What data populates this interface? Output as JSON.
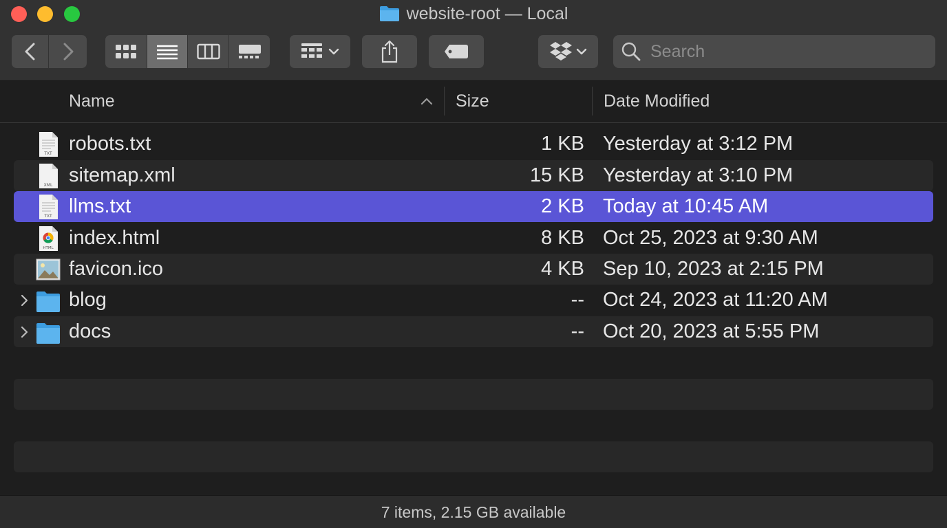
{
  "window": {
    "title": "website-root — Local"
  },
  "toolbar": {
    "back": "back",
    "forward": "forward",
    "search_placeholder": "Search"
  },
  "columns": {
    "name": "Name",
    "size": "Size",
    "date": "Date Modified",
    "sort_column": "Name",
    "sort_direction": "ascending"
  },
  "files": [
    {
      "name": "robots.txt",
      "size": "1 KB",
      "date": "Yesterday at 3:12 PM",
      "icon": "text-file-icon",
      "kind": "file",
      "selected": false
    },
    {
      "name": "sitemap.xml",
      "size": "15 KB",
      "date": "Yesterday at 3:10 PM",
      "icon": "xml-file-icon",
      "kind": "file",
      "selected": false
    },
    {
      "name": "llms.txt",
      "size": "2 KB",
      "date": "Today at 10:45 AM",
      "icon": "text-file-icon",
      "kind": "file",
      "selected": true
    },
    {
      "name": "index.html",
      "size": "8 KB",
      "date": "Oct 25, 2023 at 9:30 AM",
      "icon": "html-file-icon",
      "kind": "file",
      "selected": false
    },
    {
      "name": "favicon.ico",
      "size": "4 KB",
      "date": "Sep 10, 2023 at 2:15 PM",
      "icon": "image-file-icon",
      "kind": "file",
      "selected": false
    },
    {
      "name": "blog",
      "size": "--",
      "date": "Oct 24, 2023 at 11:20 AM",
      "icon": "folder-icon",
      "kind": "folder",
      "selected": false
    },
    {
      "name": "docs",
      "size": "--",
      "date": "Oct 20, 2023 at 5:55 PM",
      "icon": "folder-icon",
      "kind": "folder",
      "selected": false
    }
  ],
  "status": {
    "text": "7 items, 2.15 GB available"
  },
  "colors": {
    "selection": "#5a55d6",
    "folder": "#3d9de0"
  }
}
